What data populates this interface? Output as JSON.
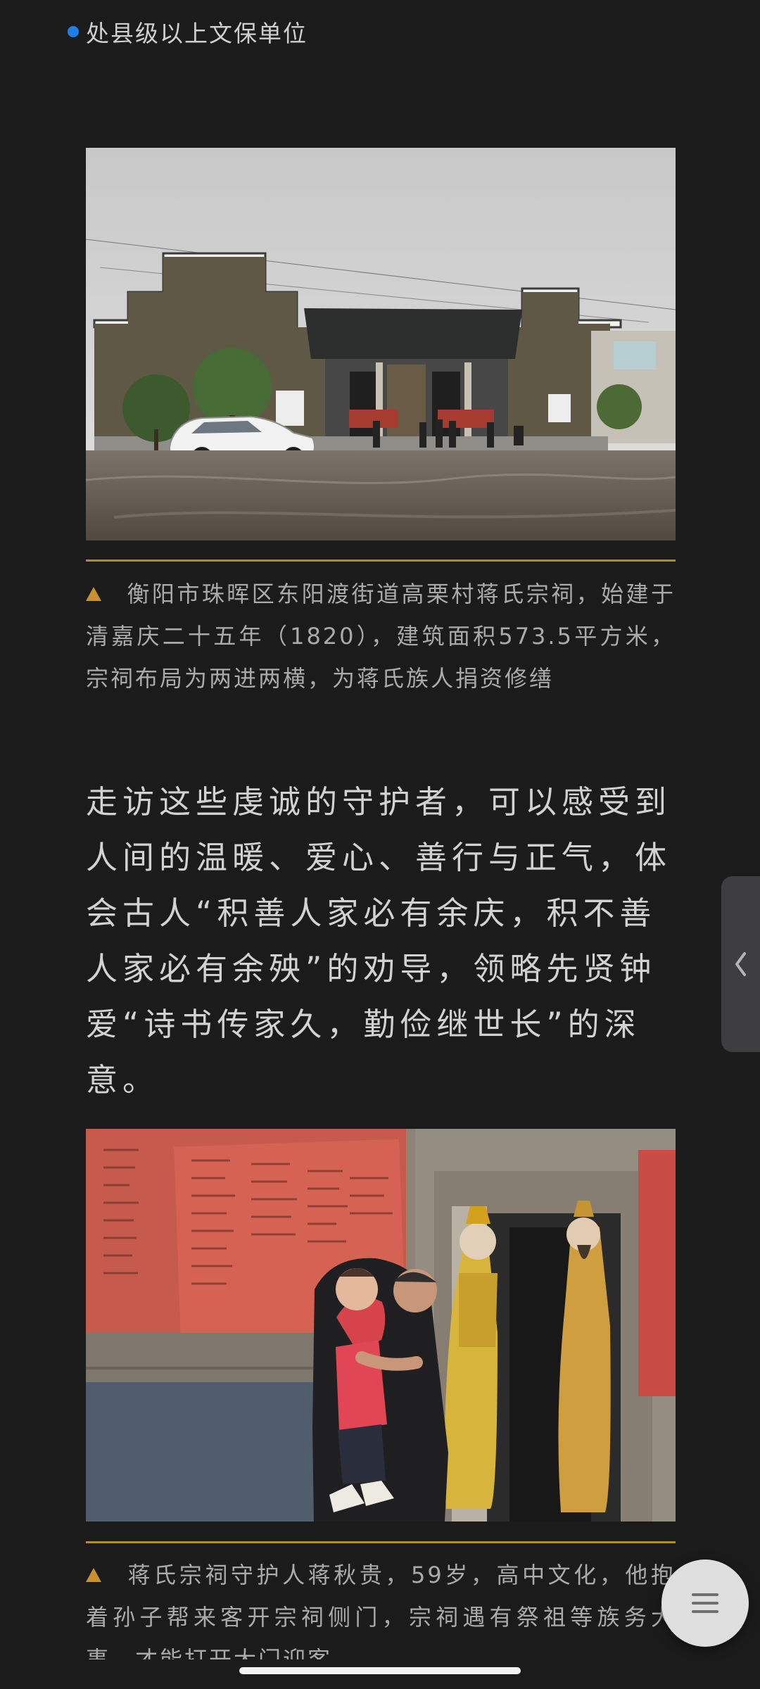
{
  "article": {
    "bullet_text": "处县级以上文保单位",
    "photo_1": {
      "caption": "衡阳市珠晖区东阳渡街道高栗村蒋氏宗祠，始建于清嘉庆二十五年（1820），建筑面积573.5平方米，宗祠布局为两进两横，为蒋氏族人捐资修缮"
    },
    "body_paragraph": "走访这些虔诚的守护者，可以感受到人间的温暖、爱心、善行与正气，体会古人“积善人家必有余庆，积不善人家必有余殃”的劝导，领略先贤钟爱“诗书传家久，勤俭继世长”的深意。",
    "photo_2": {
      "caption": "蒋氏宗祠守护人蒋秋贵，59岁，高中文化，他抱着孙子帮来客开宗祠侧门，宗祠遇有祭祖等族务大事，才能打开大门迎客"
    }
  },
  "controls": {
    "side_tab_icon": "chevron-left-icon",
    "menu_icon": "menu-icon"
  },
  "colors": {
    "background": "#1b1b1c",
    "accent_gold": "#b08a39",
    "bullet_blue": "#1f7fe8",
    "caption_triangle": "#c7922d"
  }
}
